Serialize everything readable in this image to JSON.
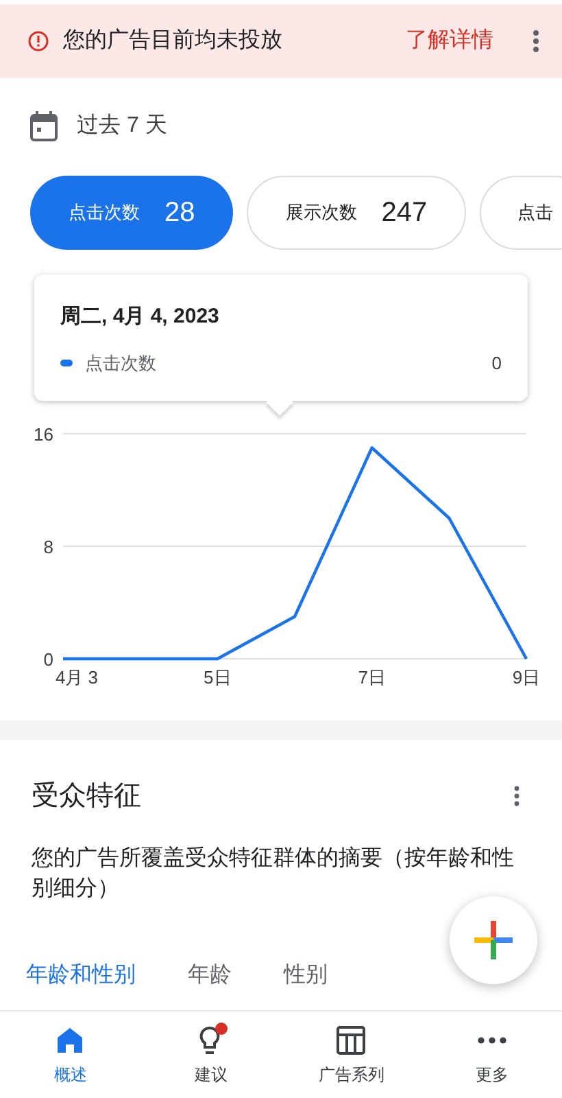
{
  "banner": {
    "message": "您的广告目前均未投放",
    "action": "了解详情"
  },
  "date_range": {
    "label": "过去 7 天"
  },
  "metrics": [
    {
      "label": "点击次数",
      "value": "28",
      "selected": true
    },
    {
      "label": "展示次数",
      "value": "247",
      "selected": false
    },
    {
      "label": "点击",
      "selected": false
    }
  ],
  "tooltip": {
    "title": "周二, 4月 4, 2023",
    "series": "点击次数",
    "value": "0",
    "color": "#1a73e8"
  },
  "chart_data": {
    "type": "line",
    "x": [
      3,
      4,
      5,
      6,
      7,
      8,
      9
    ],
    "series": [
      {
        "color": "#1a73e8",
        "values": [
          0,
          0,
          0,
          3,
          15,
          10,
          0
        ]
      }
    ],
    "xticks": [
      {
        "value": 3,
        "label": "4月 3"
      },
      {
        "value": 5,
        "label": "5日"
      },
      {
        "value": 7,
        "label": "7日"
      },
      {
        "value": 9,
        "label": "9日"
      }
    ],
    "yticks": [
      0,
      8,
      16
    ],
    "xlim": [
      3,
      9
    ],
    "ylim": [
      0,
      16
    ]
  },
  "audience": {
    "title": "受众特征",
    "description": "您的广告所覆盖受众特征群体的摘要（按年龄和性别细分）",
    "tabs": [
      {
        "label": "年龄和性别",
        "selected": true
      },
      {
        "label": "年龄",
        "selected": false
      },
      {
        "label": "性别",
        "selected": false
      }
    ]
  },
  "bottom_nav": [
    {
      "kind": "home",
      "label": "概述",
      "selected": true,
      "badge": false
    },
    {
      "kind": "bulb",
      "label": "建议",
      "selected": false,
      "badge": true
    },
    {
      "kind": "table",
      "label": "广告系列",
      "selected": false,
      "badge": false
    },
    {
      "kind": "more",
      "label": "更多",
      "selected": false,
      "badge": false
    }
  ]
}
